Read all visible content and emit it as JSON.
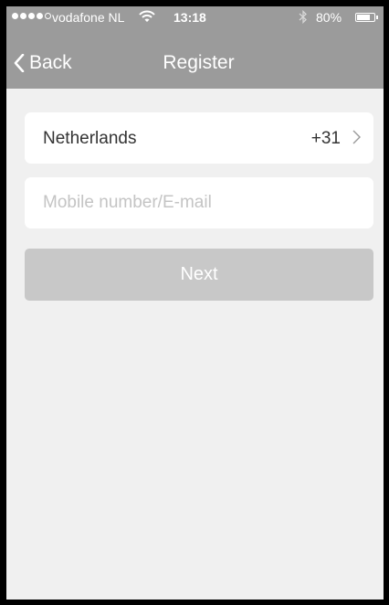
{
  "status_bar": {
    "signal": {
      "filled": 4,
      "total": 5
    },
    "carrier": "vodafone NL",
    "wifi_icon": "wifi-icon",
    "time": "13:18",
    "bluetooth_icon": "bluetooth-icon",
    "battery_percent": "80%",
    "battery_level": 0.8
  },
  "nav": {
    "back_label": "Back",
    "title": "Register"
  },
  "country": {
    "name": "Netherlands",
    "code": "+31"
  },
  "identifier_input": {
    "value": "",
    "placeholder": "Mobile number/E-mail"
  },
  "next_button": {
    "label": "Next",
    "enabled": false
  },
  "colors": {
    "header": "#9b9b9b",
    "background": "#f0f0f0",
    "button_disabled": "#c8c8c8",
    "placeholder": "#c4c4c4"
  }
}
